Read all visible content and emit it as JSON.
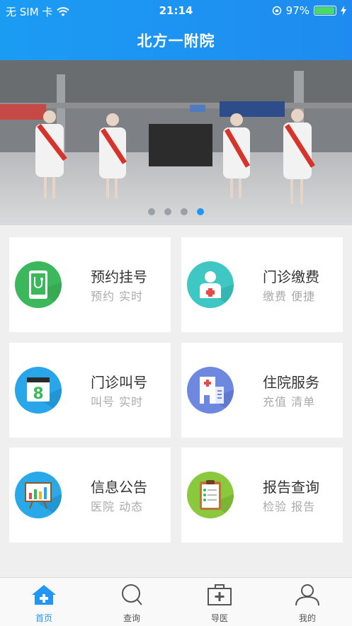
{
  "status": {
    "carrier": "无 SIM 卡",
    "time": "21:14",
    "battery": "97%"
  },
  "header": {
    "title": "北方一附院"
  },
  "banner": {
    "slide_count": 4,
    "active_slide": 4
  },
  "cards": [
    {
      "title": "预约挂号",
      "subtitle": "预约 实时",
      "icon": "phone-stethoscope-icon",
      "color": "#3cb85c"
    },
    {
      "title": "门诊缴费",
      "subtitle": "缴费 便捷",
      "icon": "doctor-icon",
      "color": "#3fc7c3"
    },
    {
      "title": "门诊叫号",
      "subtitle": "叫号 实时",
      "icon": "calendar-8-icon",
      "color": "#29a6ea"
    },
    {
      "title": "住院服务",
      "subtitle": "充值 清单",
      "icon": "hospital-building-icon",
      "color": "#6e88e0"
    },
    {
      "title": "信息公告",
      "subtitle": "医院 动态",
      "icon": "presentation-board-icon",
      "color": "#2aa9e8"
    },
    {
      "title": "报告查询",
      "subtitle": "检验 报告",
      "icon": "clipboard-icon",
      "color": "#8ac83d"
    }
  ],
  "tabs": [
    {
      "label": "首页",
      "icon": "home-icon"
    },
    {
      "label": "查询",
      "icon": "search-icon"
    },
    {
      "label": "导医",
      "icon": "medical-kit-icon"
    },
    {
      "label": "我的",
      "icon": "user-icon"
    }
  ],
  "colors": {
    "primary": "#2196f3",
    "header": "#1b9cf3"
  }
}
